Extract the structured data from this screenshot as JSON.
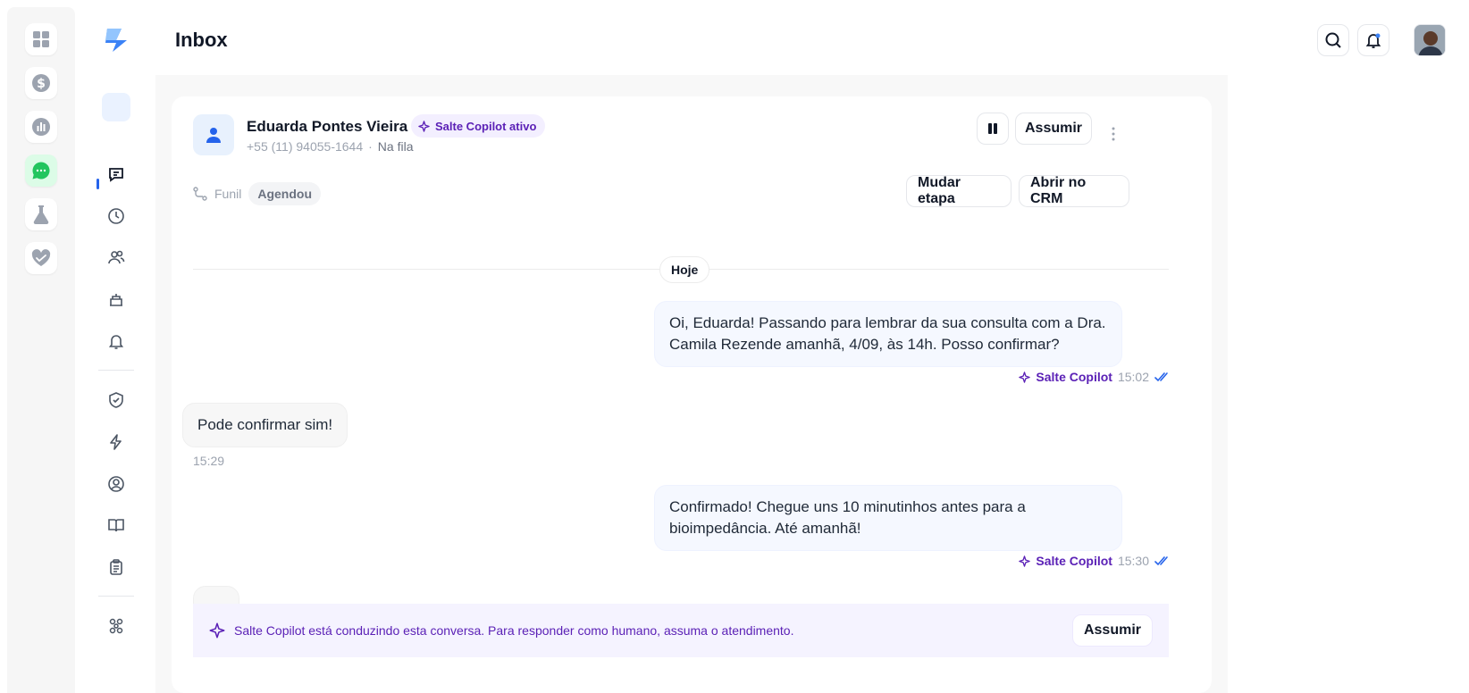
{
  "header": {
    "title": "Inbox"
  },
  "conversation": {
    "contact_name": "Eduarda Pontes Vieira",
    "copilot_badge": "Salte Copilot ativo",
    "phone": "+55 (11) 94055-1644",
    "separator": "·",
    "status": "Na fila",
    "pause_icon": "pause-icon",
    "assume_label": "Assumir",
    "funnel_label": "Funil",
    "stage": "Agendou",
    "change_stage_label": "Mudar etapa",
    "open_crm_label": "Abrir no CRM",
    "day_divider": "Hoje"
  },
  "messages": [
    {
      "direction": "out",
      "text_line1": "Oi, Eduarda! Passando para lembrar da sua consulta com a Dra.",
      "text_line2": "Camila Rezende amanhã, 4/09, às 14h. Posso confirmar?",
      "sender": "Salte Copilot",
      "time": "15:02"
    },
    {
      "direction": "in",
      "text": "Pode confirmar sim!",
      "time": "15:29"
    },
    {
      "direction": "out",
      "text_line1": "Confirmado! Chegue uns 10 minutinhos antes para a",
      "text_line2": "bioimpedância. Até amanhã!",
      "sender": "Salte Copilot",
      "time": "15:30"
    }
  ],
  "notice": {
    "text": "Salte Copilot está conduzindo esta conversa. Para responder como humano, assuma o atendimento.",
    "button_label": "Assumir"
  },
  "colors": {
    "accent": "#2563eb",
    "copilot": "#5b21b6",
    "active_rail": "#dcfce7"
  }
}
